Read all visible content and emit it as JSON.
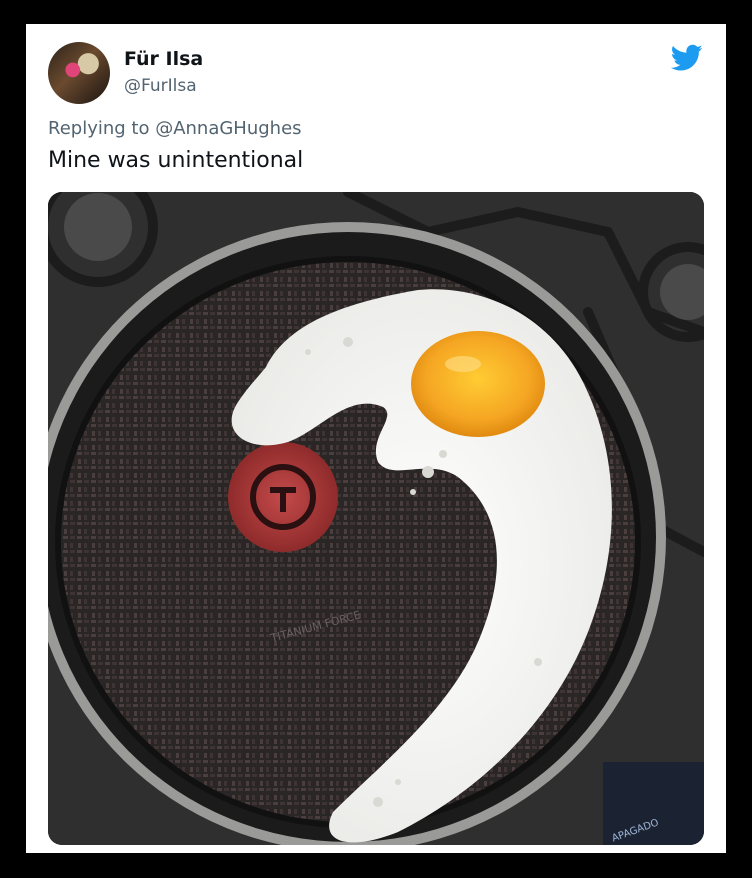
{
  "tweet": {
    "display_name": "Für Ilsa",
    "handle": "@FurIlsa",
    "reply_prefix": "Replying to @AnnaGHughes",
    "text": "Mine was unintentional",
    "photo_caption": "TITANIUM FORCE",
    "stove_text": "APAGADO"
  },
  "colors": {
    "brand_blue": "#1d9bf0",
    "text_primary": "#0f1419",
    "text_secondary": "#536471"
  }
}
